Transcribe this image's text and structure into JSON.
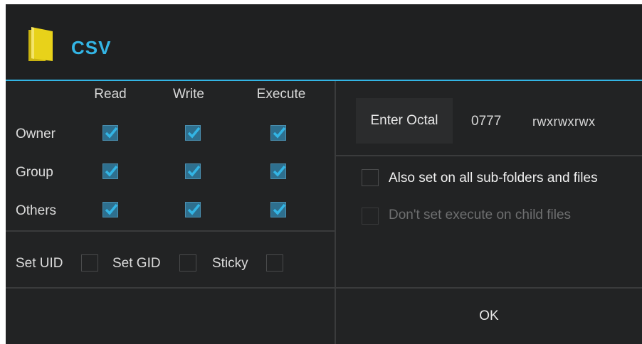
{
  "dialog": {
    "title": "CSV",
    "icon": "folder-icon"
  },
  "permissions": {
    "columns": [
      "Read",
      "Write",
      "Execute"
    ],
    "rows": [
      {
        "label": "Owner",
        "read": true,
        "write": true,
        "execute": true
      },
      {
        "label": "Group",
        "read": true,
        "write": true,
        "execute": true
      },
      {
        "label": "Others",
        "read": true,
        "write": true,
        "execute": true
      }
    ]
  },
  "special_bits": {
    "set_uid": {
      "label": "Set UID",
      "checked": false
    },
    "set_gid": {
      "label": "Set GID",
      "checked": false
    },
    "sticky": {
      "label": "Sticky",
      "checked": false
    }
  },
  "octal": {
    "button_label": "Enter Octal",
    "value": "0777",
    "symbolic": "rwxrwxrwx"
  },
  "options": {
    "recursive": {
      "label": "Also set on all sub-folders and files",
      "checked": false,
      "enabled": true
    },
    "no_exec_child": {
      "label": "Don't set execute on child files",
      "checked": false,
      "enabled": false
    }
  },
  "footer": {
    "ok_label": "OK"
  },
  "colors": {
    "accent": "#33b5e5",
    "background": "#222324",
    "checkbox_fill": "#2e6f8e",
    "folder_yellow": "#e8d21a"
  }
}
